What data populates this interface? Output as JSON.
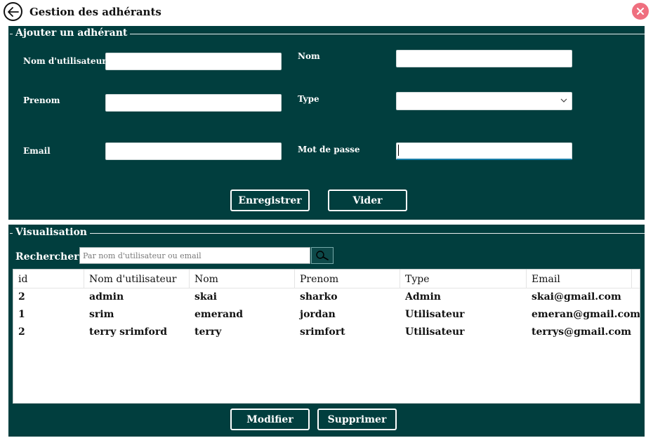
{
  "window": {
    "title": "Gestion des adhérants"
  },
  "form": {
    "legend": "Ajouter un adhérant",
    "fields": {
      "username": {
        "label": "Nom d'utilisateur",
        "value": ""
      },
      "nom": {
        "label": "Nom",
        "value": ""
      },
      "prenom": {
        "label": "Prenom",
        "value": ""
      },
      "type": {
        "label": "Type",
        "selected": ""
      },
      "email": {
        "label": "Email",
        "value": ""
      },
      "password": {
        "label": "Mot de passe",
        "value": ""
      }
    },
    "buttons": {
      "save": "Enregistrer",
      "clear": "Vider"
    }
  },
  "view": {
    "legend": "Visualisation",
    "search": {
      "label": "Rechercher",
      "placeholder": "Par nom d'utilisateur ou email"
    },
    "table": {
      "columns": [
        "id",
        "Nom d'utilisateur",
        "Nom",
        "Prenom",
        "Type",
        "Email"
      ],
      "rows": [
        [
          "2",
          "admin",
          "skai",
          "sharko",
          "Admin",
          "skai@gmail.com"
        ],
        [
          "1",
          "srim",
          "emerand",
          "jordan",
          "Utilisateur",
          "emeran@gmail.com"
        ],
        [
          "2",
          "terry srimford",
          "terry",
          "srimfort",
          "Utilisateur",
          "terrys@gmail.com"
        ]
      ]
    },
    "buttons": {
      "modify": "Modifier",
      "delete": "Supprimer"
    }
  },
  "colors": {
    "panel": "#013e3e",
    "close": "#ef6f7f",
    "focus": "#1a7fa8"
  },
  "icons": {
    "back": "arrow-left-circle-icon",
    "close": "close-icon",
    "search": "magnifier-icon",
    "select": "chevron-down-icon"
  }
}
